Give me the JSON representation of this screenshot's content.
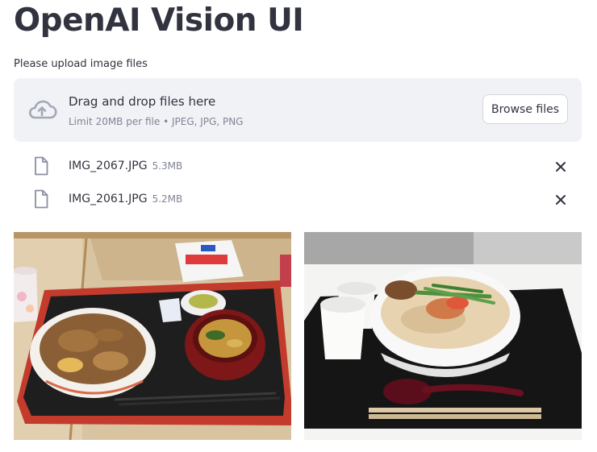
{
  "page": {
    "title": "OpenAI Vision UI"
  },
  "uploader": {
    "label": "Please upload image files",
    "drop_title": "Drag and drop files here",
    "drop_subtitle": "Limit 20MB per file • JPEG, JPG, PNG",
    "browse_label": "Browse files",
    "icon": "cloud-upload-icon"
  },
  "files": [
    {
      "name": "IMG_2067.JPG",
      "size": "5.3MB"
    },
    {
      "name": "IMG_2061.JPG",
      "size": "5.2MB"
    }
  ],
  "images": [
    {
      "description": "gyudon-meal-photo"
    },
    {
      "description": "ramen-bowl-photo"
    }
  ]
}
